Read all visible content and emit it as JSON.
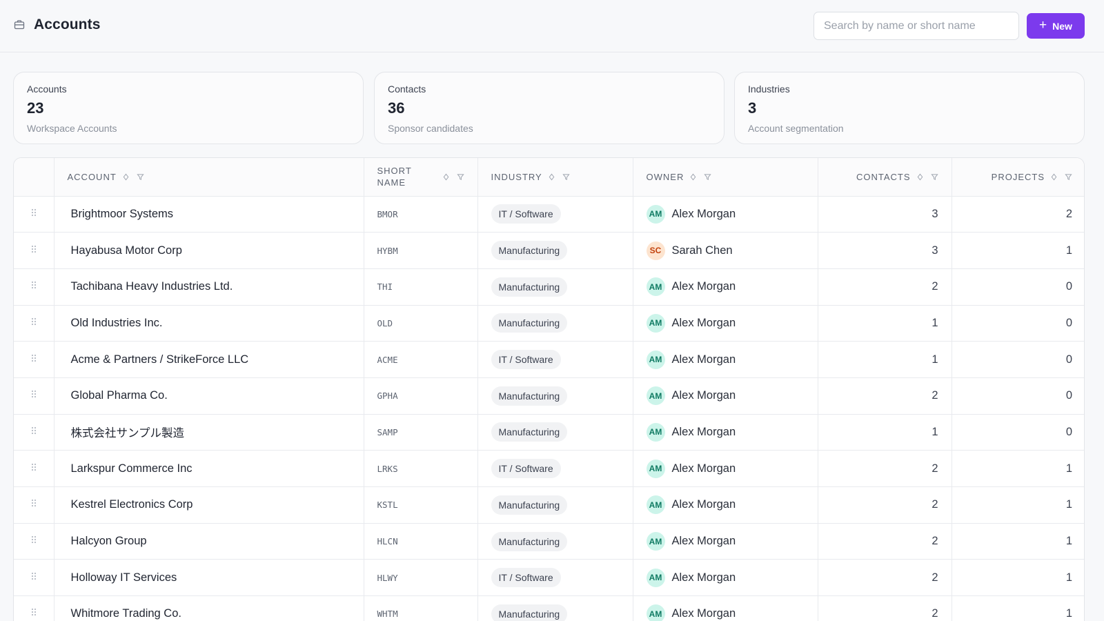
{
  "header": {
    "title": "Accounts",
    "search_placeholder": "Search by name or short name",
    "search_value": "",
    "new_label": "New"
  },
  "stats": [
    {
      "label": "Accounts",
      "value": "23",
      "sub": "Workspace Accounts"
    },
    {
      "label": "Contacts",
      "value": "36",
      "sub": "Sponsor candidates"
    },
    {
      "label": "Industries",
      "value": "3",
      "sub": "Account segmentation"
    }
  ],
  "columns": {
    "account": "ACCOUNT",
    "short_name": "SHORT\nNAME",
    "industry": "INDUSTRY",
    "owner": "OWNER",
    "contacts": "CONTACTS",
    "projects": "PROJECTS"
  },
  "colors": {
    "accent": "#7c3aed",
    "avatar_am": "#ccf4ea",
    "avatar_sc": "#fde4cf"
  },
  "rows": [
    {
      "name": "Brightmoor Systems",
      "short": "BMOR",
      "industry": "IT / Software",
      "owner_initials": "AM",
      "owner": "Alex Morgan",
      "contacts": "3",
      "projects": "2"
    },
    {
      "name": "Hayabusa Motor Corp",
      "short": "HYBM",
      "industry": "Manufacturing",
      "owner_initials": "SC",
      "owner": "Sarah Chen",
      "contacts": "3",
      "projects": "1"
    },
    {
      "name": "Tachibana Heavy Industries Ltd.",
      "short": "THI",
      "industry": "Manufacturing",
      "owner_initials": "AM",
      "owner": "Alex Morgan",
      "contacts": "2",
      "projects": "0"
    },
    {
      "name": "Old Industries Inc.",
      "short": "OLD",
      "industry": "Manufacturing",
      "owner_initials": "AM",
      "owner": "Alex Morgan",
      "contacts": "1",
      "projects": "0"
    },
    {
      "name": "Acme & Partners / StrikeForce LLC",
      "short": "ACME",
      "industry": "IT / Software",
      "owner_initials": "AM",
      "owner": "Alex Morgan",
      "contacts": "1",
      "projects": "0"
    },
    {
      "name": "Global Pharma Co.",
      "short": "GPHA",
      "industry": "Manufacturing",
      "owner_initials": "AM",
      "owner": "Alex Morgan",
      "contacts": "2",
      "projects": "0"
    },
    {
      "name": "株式会社サンプル製造",
      "short": "SAMP",
      "industry": "Manufacturing",
      "owner_initials": "AM",
      "owner": "Alex Morgan",
      "contacts": "1",
      "projects": "0"
    },
    {
      "name": "Larkspur Commerce Inc",
      "short": "LRKS",
      "industry": "IT / Software",
      "owner_initials": "AM",
      "owner": "Alex Morgan",
      "contacts": "2",
      "projects": "1"
    },
    {
      "name": "Kestrel Electronics Corp",
      "short": "KSTL",
      "industry": "Manufacturing",
      "owner_initials": "AM",
      "owner": "Alex Morgan",
      "contacts": "2",
      "projects": "1"
    },
    {
      "name": "Halcyon Group",
      "short": "HLCN",
      "industry": "Manufacturing",
      "owner_initials": "AM",
      "owner": "Alex Morgan",
      "contacts": "2",
      "projects": "1"
    },
    {
      "name": "Holloway IT Services",
      "short": "HLWY",
      "industry": "IT / Software",
      "owner_initials": "AM",
      "owner": "Alex Morgan",
      "contacts": "2",
      "projects": "1"
    },
    {
      "name": "Whitmore Trading Co.",
      "short": "WHTM",
      "industry": "Manufacturing",
      "owner_initials": "AM",
      "owner": "Alex Morgan",
      "contacts": "2",
      "projects": "1"
    }
  ]
}
